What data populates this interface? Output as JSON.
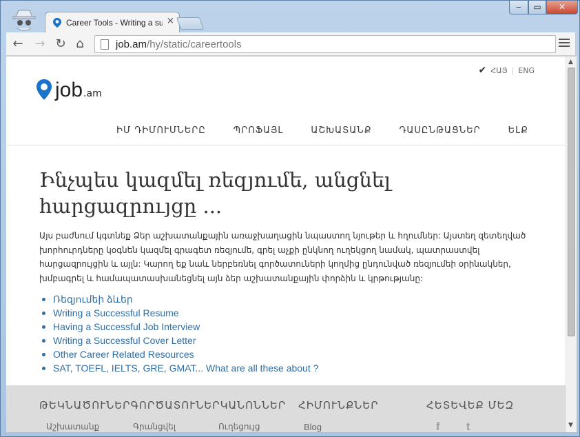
{
  "browser": {
    "tab_title": "Career Tools - Writing a su",
    "tab_close": "×",
    "url_host": "job.am",
    "url_path": "/hy/static/careertools",
    "window": {
      "minimize": "‒",
      "maximize": "▭",
      "close": "✕"
    },
    "nav": {
      "back": "←",
      "forward": "→",
      "reload": "↻",
      "home": "⌂"
    }
  },
  "site": {
    "lang": {
      "hy": "ՀԱՅ",
      "en": "ENG",
      "separator": "|"
    },
    "logo": {
      "text": "job",
      "tld": ".am"
    },
    "nav": [
      "ԻՄ ԴԻՄՈՒՄՆԵՐԸ",
      "ՊՐՈՖԱՅԼ",
      "ԱՇԽԱՏԱՆՔ",
      "ԴԱՍԸՆԹԱՑՆԵՐ",
      "ԵԼՔ"
    ]
  },
  "content": {
    "heading": "Ինչպես կազմել ռեզյումե, անցնել հարցազրույցը ...",
    "intro": "Այս բաժնում կգտնեք Ձեր աշխատանքային առաջխաղացին նպաստող նյութեր և հղումներ: Այստեղ զետեղված խորհուրդները կօգնեն կազմել գրագետ ռեզյումե, գրել աչքի ընկնող ուղեկցող նամակ, պատրաստվել հարցազրույցին և այլն: Կարող եք նաև ներբեռնել գործատուների կողմից ընդունված ռեզյումեի օրինակներ, խմբագրել և համապատասխանեցնել այն ձեր աշխատանքային փորձին և կրթությանը:",
    "links": [
      "Ռեզյումեի ձևեր",
      "Writing a Successful Resume",
      "Having a Successful Job Interview",
      "Writing a Successful Cover Letter",
      "Other Career Related Resources",
      "SAT, TOEFL, IELTS, GRE, GMAT... What are all these about ?"
    ]
  },
  "footer": {
    "headings": [
      "ԹԵԿՆԱԾՈՒՆԵՐԳՈՐԾԱՏՈՒՆԵՐԿԱՆՈՆՆԵՐ",
      "ՀԻՄՈՒՆՔՆԵՐ",
      "ՀԵՏԵՎԵՔ ՄԵԶ"
    ],
    "links": [
      "Աշխատանք",
      "Գրանցվել",
      "Ուղեցույց",
      "Blog"
    ],
    "social": {
      "facebook": "f",
      "twitter": "t"
    }
  },
  "colors": {
    "link": "#2e6da4",
    "footer_bg": "#dcdcdc",
    "logo_pin": "#1a73c8"
  }
}
